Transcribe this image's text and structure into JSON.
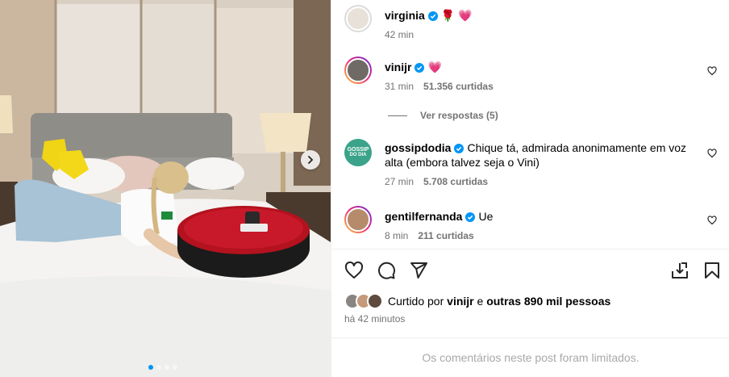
{
  "post": {
    "carousel": {
      "dot_count": 4,
      "active_index": 0
    }
  },
  "caption": {
    "username": "virginia",
    "emojis": "🌹 💗",
    "time": "42 min"
  },
  "comments": [
    {
      "username": "vinijr",
      "text": "💗",
      "time": "31 min",
      "likes": "51.356 curtidas"
    },
    {
      "username": "gossipdodia",
      "text": "Chique tá, admirada anonimamente em voz alta (embora talvez seja o Vini)",
      "time": "27 min",
      "likes": "5.708 curtidas"
    },
    {
      "username": "gentilfernanda",
      "text": "Ue",
      "time": "8 min",
      "likes": "211 curtidas"
    }
  ],
  "replies_label": "Ver respostas (5)",
  "avatar_text": {
    "gossip": "GOSSIP",
    "dodia": "DO DIA"
  },
  "likes_summary": {
    "prefix": "Curtido por",
    "user": "vinijr",
    "middle": "e",
    "others": "outras 890 mil pessoas"
  },
  "posted_ago": "há 42 minutos",
  "comments_limited": "Os comentários neste post foram limitados.",
  "colors": {
    "verified": "#0095f6",
    "heart": "#ff3040",
    "muted": "#737373"
  },
  "icons": [
    "like-icon",
    "comment-icon",
    "share-icon",
    "save-icon",
    "bookmark-icon",
    "chevron-right-icon",
    "verified-icon"
  ]
}
